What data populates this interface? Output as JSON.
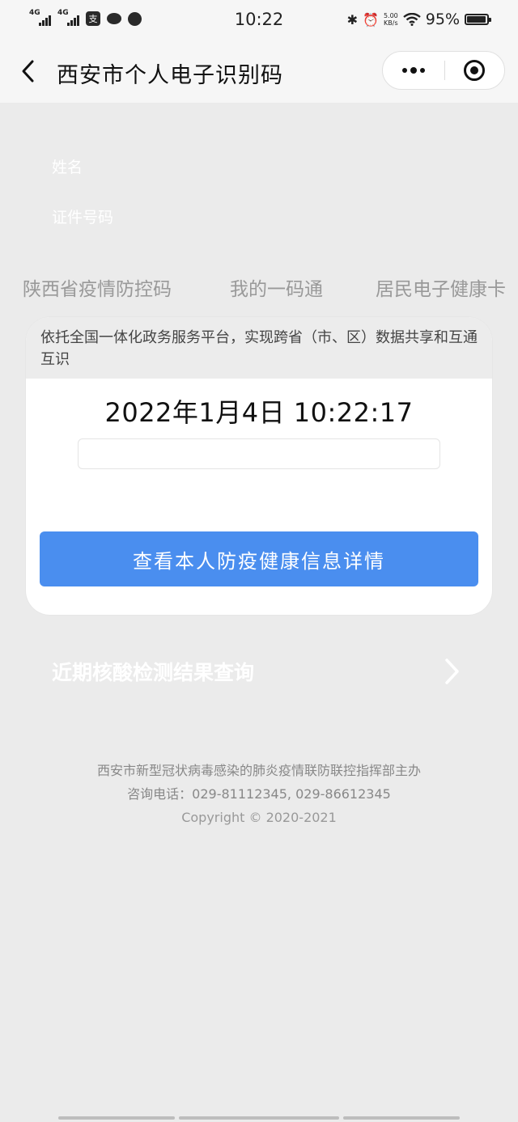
{
  "status_bar": {
    "network1": "4G",
    "network2": "4G",
    "time": "10:22",
    "speed_value": "5.00",
    "speed_unit": "KB/s",
    "battery": "95%",
    "battery_level": 0.95
  },
  "nav": {
    "title": "西安市个人电子识别码"
  },
  "info": {
    "name_label": "姓名",
    "id_label": "证件号码"
  },
  "tabs": [
    "陕西省疫情防控码",
    "我的一码通",
    "居民电子健康卡"
  ],
  "card": {
    "notice": "依托全国一体化政务服务平台，实现跨省（市、区）数据共享和互通互识",
    "datetime": "2022年1月4日 10:22:17",
    "button_label": "查看本人防疫健康信息详情"
  },
  "nucleic_link": "近期核酸检测结果查询",
  "footer": {
    "organizer": "西安市新型冠状病毒感染的肺炎疫情联防联控指挥部主办",
    "hotline": "咨询电话：029-81112345, 029-86612345",
    "copyright": "Copyright © 2020-2021"
  }
}
